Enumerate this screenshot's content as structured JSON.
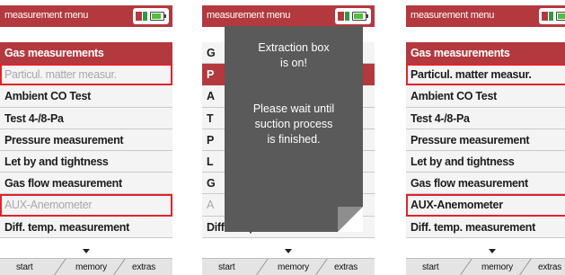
{
  "colors": {
    "accent": "#b3393f",
    "highlight_frame": "#e0242b",
    "overlay": "#5a5a5a"
  },
  "screens": [
    {
      "title": "measurement menu",
      "items": [
        "Gas measurements",
        "Particul. matter measur.",
        "Ambient CO Test",
        "Test 4-/8-Pa",
        "Pressure measurement",
        "Let by and tightness",
        "Gas flow measurement",
        "AUX-Anemometer",
        "Diff. temp. measurement"
      ],
      "tabs": [
        "start",
        "memory",
        "extras"
      ]
    },
    {
      "title": "measurement menu",
      "items": [
        "G",
        "P",
        "A",
        "T",
        "P",
        "L",
        "G",
        "A",
        "Diff. temp. measurement"
      ],
      "tabs": [
        "start",
        "memory",
        "extras"
      ],
      "overlay": {
        "line1": "Extraction box",
        "line2": "is on!",
        "line3": "Please wait until",
        "line4": "suction process",
        "line5": "is finished."
      }
    },
    {
      "title": "measurement menu",
      "items": [
        "Gas measurements",
        "Particul. matter measur.",
        "Ambient CO Test",
        "Test 4-/8-Pa",
        "Pressure measurement",
        "Let by and tightness",
        "Gas flow measurement",
        "AUX-Anemometer",
        "Diff. temp. measurement"
      ],
      "tabs": [
        "start",
        "memory",
        "extras"
      ]
    }
  ]
}
